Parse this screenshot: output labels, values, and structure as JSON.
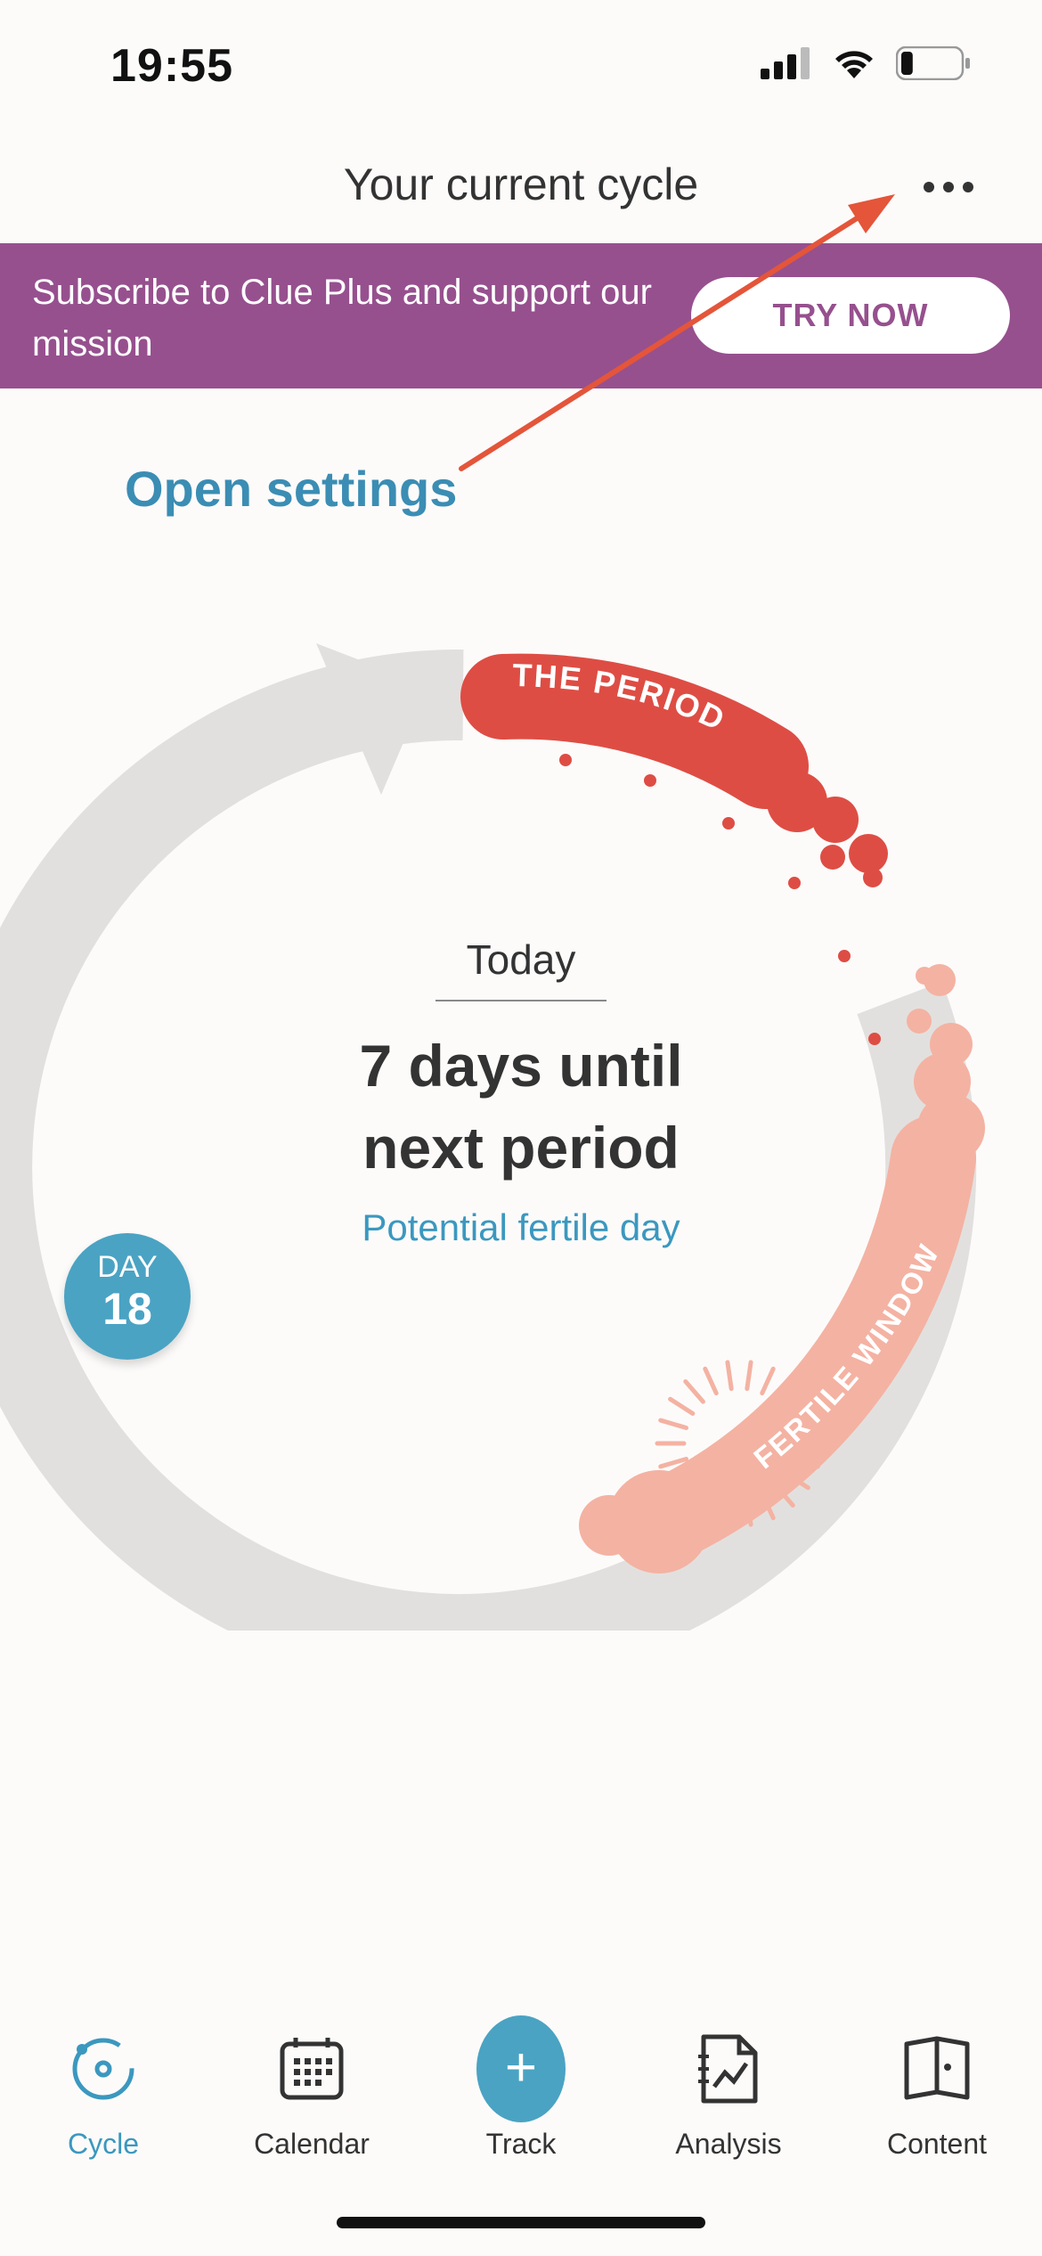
{
  "status": {
    "time": "19:55",
    "battery_level": 0.2
  },
  "header": {
    "title": "Your current cycle",
    "more_icon": "ellipsis-icon"
  },
  "promo": {
    "text": "Subscribe to Clue Plus and support our mission",
    "button_label": "TRY NOW"
  },
  "annotation": {
    "label": "Open settings",
    "color": "#e4553a"
  },
  "cycle": {
    "period_label": "THE PERIOD",
    "fertile_label": "FERTILE WINDOW",
    "today_label": "Today",
    "countdown_line1": "7 days until",
    "countdown_line2": "next period",
    "note": "Potential fertile day",
    "day_label": "DAY",
    "day_number": "18",
    "colors": {
      "period": "#de4d44",
      "fertile": "#f4b2a2",
      "track": "#e2e0de",
      "accent": "#4aa3c3",
      "brand": "#96508e"
    }
  },
  "tabs": [
    {
      "label": "Cycle",
      "icon": "cycle-icon",
      "active": true
    },
    {
      "label": "Calendar",
      "icon": "calendar-icon",
      "active": false
    },
    {
      "label": "Track",
      "icon": "plus-icon",
      "active": false
    },
    {
      "label": "Analysis",
      "icon": "analysis-icon",
      "active": false
    },
    {
      "label": "Content",
      "icon": "book-icon",
      "active": false
    }
  ]
}
